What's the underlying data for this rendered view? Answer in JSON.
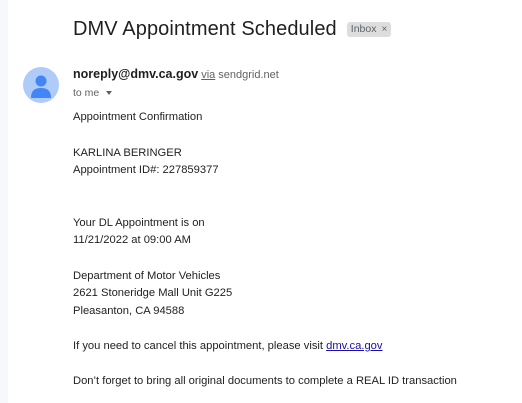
{
  "email": {
    "subject": "DMV Appointment Scheduled",
    "label": "Inbox",
    "label_close": "×",
    "sender_email": "noreply@dmv.ca.gov",
    "via_word": "via",
    "via_domain": "sendgrid.net",
    "recipient": "to me",
    "body": {
      "heading": "Appointment Confirmation",
      "name": "KARLINA BERINGER",
      "appointment_id": "Appointment ID#: 227859377",
      "dl_line": "Your DL Appointment is on",
      "datetime": "11/21/2022 at 09:00 AM",
      "office_name": "Department of Motor Vehicles",
      "office_street": "2621 Stoneridge Mall Unit G225",
      "office_city": "Pleasanton, CA 94588",
      "cancel_text": "If you need to cancel this appointment, please visit ",
      "cancel_link": "dmv.ca.gov",
      "reminder": "Don’t forget to bring all original documents to complete a REAL ID transaction"
    }
  },
  "icons": {
    "avatar": "person-icon",
    "recipient_toggle": "chevron-down-icon",
    "label_remove": "close-icon"
  },
  "colors": {
    "avatar_bg": "#aecbfa",
    "avatar_fg": "#4285f4",
    "link": "#1a0dab"
  }
}
